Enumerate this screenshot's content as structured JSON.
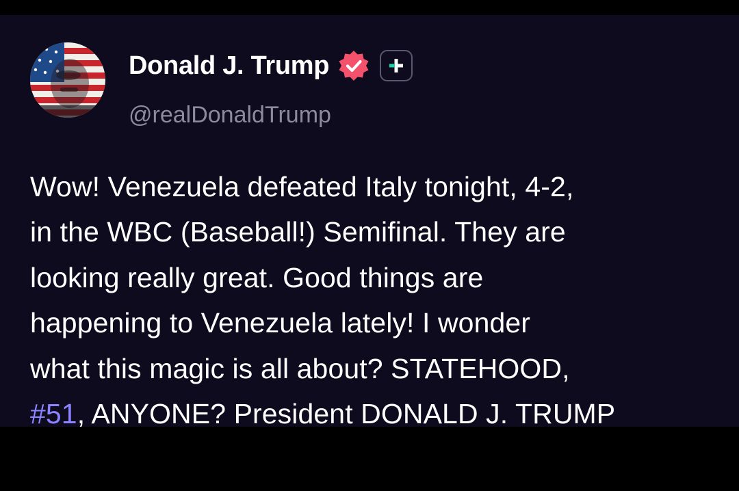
{
  "author": {
    "display_name": "Donald J. Trump",
    "handle": "@realDonaldTrump",
    "verified": true,
    "verified_badge_color": "#f4516c"
  },
  "follow_button": {
    "icon": "plus-icon",
    "accent_color": "#19d3a7"
  },
  "post": {
    "lines": [
      "Wow! Venezuela defeated Italy tonight, 4-2,",
      "in the WBC (Baseball!) Semifinal. They are",
      "looking really great. Good things are",
      "happening to Venezuela lately! I wonder",
      "what this magic is all about? STATEHOOD,"
    ],
    "last_line": {
      "hashtag": "#51",
      "rest": ", ANYONE? President DONALD J. TRUMP"
    }
  },
  "theme": {
    "card_background": "#0d0b1d",
    "hashtag_color": "#8b83ff",
    "handle_color": "#8d8a9e"
  }
}
